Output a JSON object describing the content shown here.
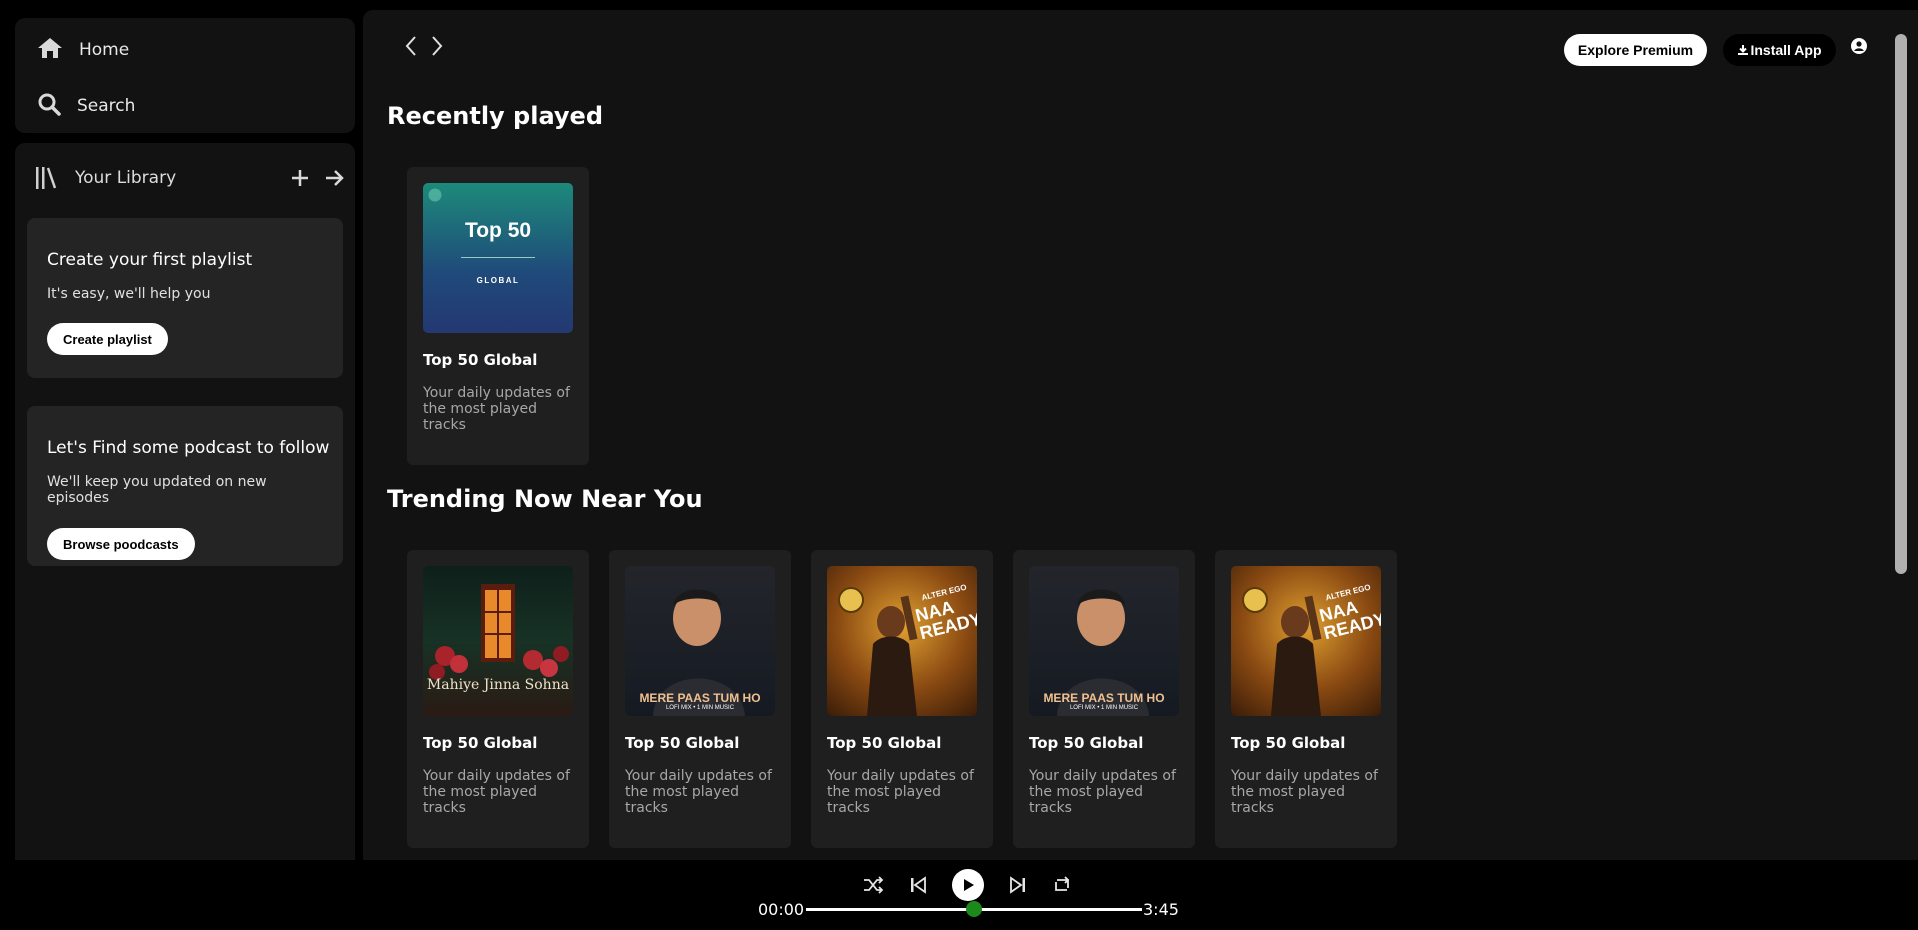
{
  "nav": {
    "home": "Home",
    "search": "Search"
  },
  "library": {
    "title": "Your Library",
    "playlist_card": {
      "title": "Create your first playlist",
      "text": "It's easy, we'll help you",
      "button": "Create playlist"
    },
    "podcast_card": {
      "title": "Let's Find some podcast to follow",
      "text": "We'll keep you updated on new episodes",
      "button": "Browse poodcasts"
    }
  },
  "header": {
    "premium": "Explore Premium",
    "install": "Install App"
  },
  "recent": {
    "heading": "Recently played",
    "items": [
      {
        "title": "Top 50 Global",
        "desc": "Your daily updates of the most played tracks",
        "cover": {
          "title": "Top 50",
          "subtitle": "GLOBAL"
        }
      }
    ]
  },
  "trending": {
    "heading": "Trending Now Near You",
    "items": [
      {
        "title": "Top 50 Global",
        "desc": "Your daily updates of the most played tracks",
        "cover": {
          "text": "Mahiye Jinna Sohna"
        }
      },
      {
        "title": "Top 50 Global",
        "desc": "Your daily updates of the most played tracks",
        "cover": {
          "text": "MERE PAAS TUM HO",
          "subtitle": "LOFI MIX • 1 MIN MUSIC"
        }
      },
      {
        "title": "Top 50 Global",
        "desc": "Your daily updates of the most played tracks",
        "cover": {
          "text": "NAA READY",
          "subtitle": "ALTER EGO"
        }
      },
      {
        "title": "Top 50 Global",
        "desc": "Your daily updates of the most played tracks",
        "cover": {
          "text": "MERE PAAS TUM HO",
          "subtitle": "LOFI MIX • 1 MIN MUSIC"
        }
      },
      {
        "title": "Top 50 Global",
        "desc": "Your daily updates of the most played tracks",
        "cover": {
          "text": "NAA READY",
          "subtitle": "ALTER EGO"
        }
      }
    ]
  },
  "player": {
    "current_time": "00:00",
    "total_time": "3:45",
    "progress": 0.5,
    "accent": "#1b8a1b"
  }
}
